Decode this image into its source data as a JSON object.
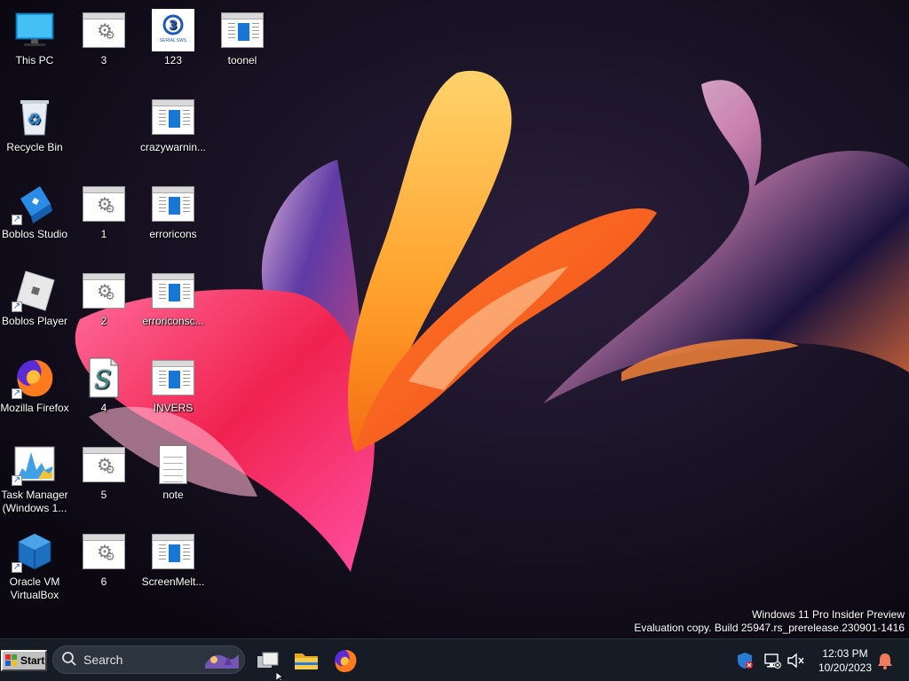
{
  "desktop": {
    "icons": [
      {
        "id": "this-pc",
        "label": "This PC"
      },
      {
        "id": "recycle-bin",
        "label": "Recycle Bin"
      },
      {
        "id": "boblos-studio",
        "label": "Boblos Studio"
      },
      {
        "id": "boblos-player",
        "label": "Boblos Player"
      },
      {
        "id": "mozilla-firefox",
        "label": "Mozilla Firefox"
      },
      {
        "id": "task-manager",
        "label": "Task Manager (Windows 1..."
      },
      {
        "id": "oracle-vm",
        "label": "Oracle VM VirtualBox"
      },
      {
        "id": "file-3",
        "label": "3"
      },
      {
        "id": "file-1",
        "label": "1"
      },
      {
        "id": "file-2",
        "label": "2"
      },
      {
        "id": "file-4",
        "label": "4"
      },
      {
        "id": "file-5",
        "label": "5"
      },
      {
        "id": "file-6",
        "label": "6"
      },
      {
        "id": "file-123",
        "label": "123",
        "logo_text": "SERIAL SWS"
      },
      {
        "id": "crazywarning",
        "label": "crazywarnin..."
      },
      {
        "id": "erroricons",
        "label": "erroricons"
      },
      {
        "id": "erroriconsc",
        "label": "erroriconsc..."
      },
      {
        "id": "invers",
        "label": "INVERS"
      },
      {
        "id": "note",
        "label": "note"
      },
      {
        "id": "screenmelt",
        "label": "ScreenMelt..."
      },
      {
        "id": "toonel",
        "label": "toonel"
      }
    ]
  },
  "watermark": {
    "line1": "Windows 11 Pro Insider Preview",
    "line2": "Evaluation copy. Build 25947.rs_prerelease.230901-1416"
  },
  "taskbar": {
    "start_label": "Start",
    "search_placeholder": "Search",
    "clock_time": "12:03 PM",
    "clock_date": "10/20/2023",
    "pinned": [
      "task-view-icon",
      "file-explorer-icon",
      "firefox-icon"
    ]
  },
  "colors": {
    "taskbar_bg": "#151c26",
    "search_bg": "#2c3440",
    "desktop_bg": "#0c0812",
    "text": "#ffffff"
  }
}
